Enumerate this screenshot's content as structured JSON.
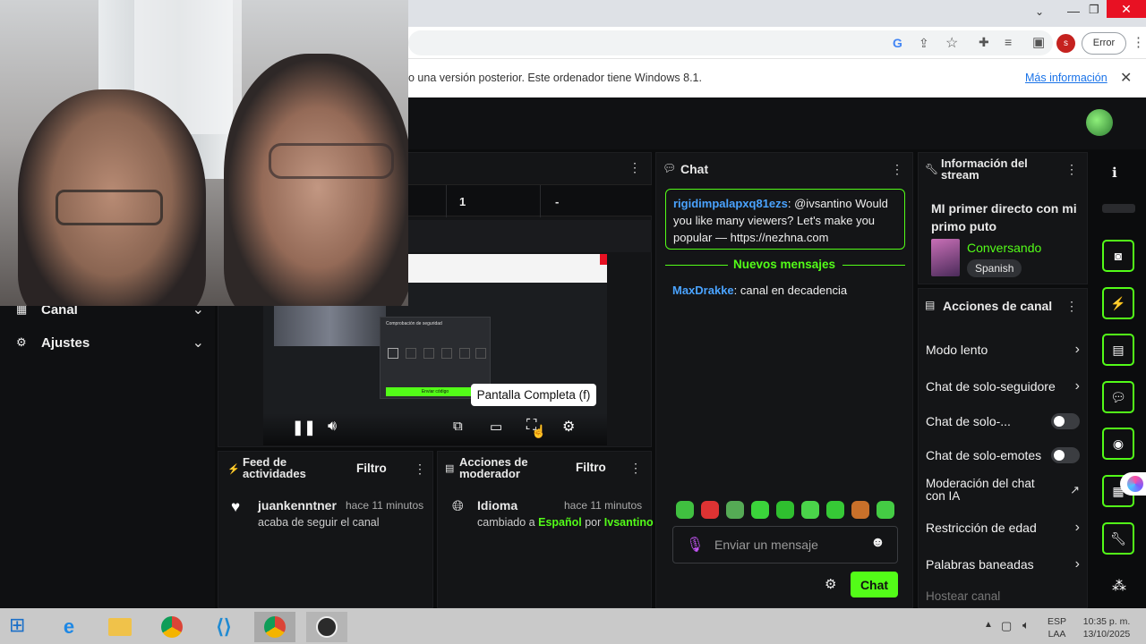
{
  "browser": {
    "error_label": "Error",
    "profile_initial": "s",
    "infobar_text": "o una versión posterior. Este ordenador tiene Windows 8.1.",
    "infobar_link": "Más información"
  },
  "left_nav": {
    "items": [
      {
        "label": "Canal"
      },
      {
        "label": "Ajustes"
      }
    ]
  },
  "stats_row": {
    "cells": [
      "1",
      "-"
    ]
  },
  "player": {
    "tooltip": "Pantalla Completa (f)",
    "inner_dialog_title": "Comprobación de seguridad",
    "inner_dialog_button": "Enviar código"
  },
  "feed": {
    "title": "Feed de actividades",
    "filter": "Filtro",
    "item": {
      "user": "juankenntner",
      "time": "hace 11 minutos",
      "text": "acaba de seguir el canal"
    }
  },
  "moderator": {
    "title": "Acciones de moderador",
    "filter": "Filtro",
    "item": {
      "title": "Idioma",
      "time": "hace 11 minutos",
      "prefix": "cambiado a",
      "lang": "Español",
      "by": "por",
      "user": "Ivsantino"
    }
  },
  "chat": {
    "title": "Chat",
    "pinned": {
      "user": "rigidimpalapxq81ezs",
      "text": ": @ivsantino Would you like many viewers? Let's make you popular — https://nezhna.com"
    },
    "new_messages_label": "Nuevos mensajes",
    "message": {
      "user": "MaxDrakke",
      "text": ": canal en decadencia"
    },
    "input_placeholder": "Enviar un mensaje",
    "send_label": "Chat"
  },
  "stream_info": {
    "title": "Información del stream",
    "stream_title": "MI primer directo con mi primo puto",
    "category": "Conversando",
    "language": "Spanish"
  },
  "channel_actions": {
    "title": "Acciones de canal",
    "items": [
      {
        "label": "Modo lento",
        "control": "chevron"
      },
      {
        "label": "Chat de solo-seguidore",
        "control": "chevron"
      },
      {
        "label": "Chat de solo-...",
        "control": "toggle"
      },
      {
        "label": "Chat de solo-emotes",
        "control": "toggle"
      },
      {
        "label": "Moderación del chat con IA",
        "control": "external"
      },
      {
        "label": "Restricción de edad",
        "control": "chevron"
      },
      {
        "label": "Palabras baneadas",
        "control": "chevron"
      },
      {
        "label": "Hostear canal",
        "control": "none"
      }
    ]
  },
  "taskbar": {
    "lang_top": "ESP",
    "lang_bottom": "LAA",
    "time": "10:35 p. m.",
    "date": "13/10/2025"
  },
  "colors": {
    "accent": "#53fc18",
    "user_blue": "#4aa3ff"
  }
}
